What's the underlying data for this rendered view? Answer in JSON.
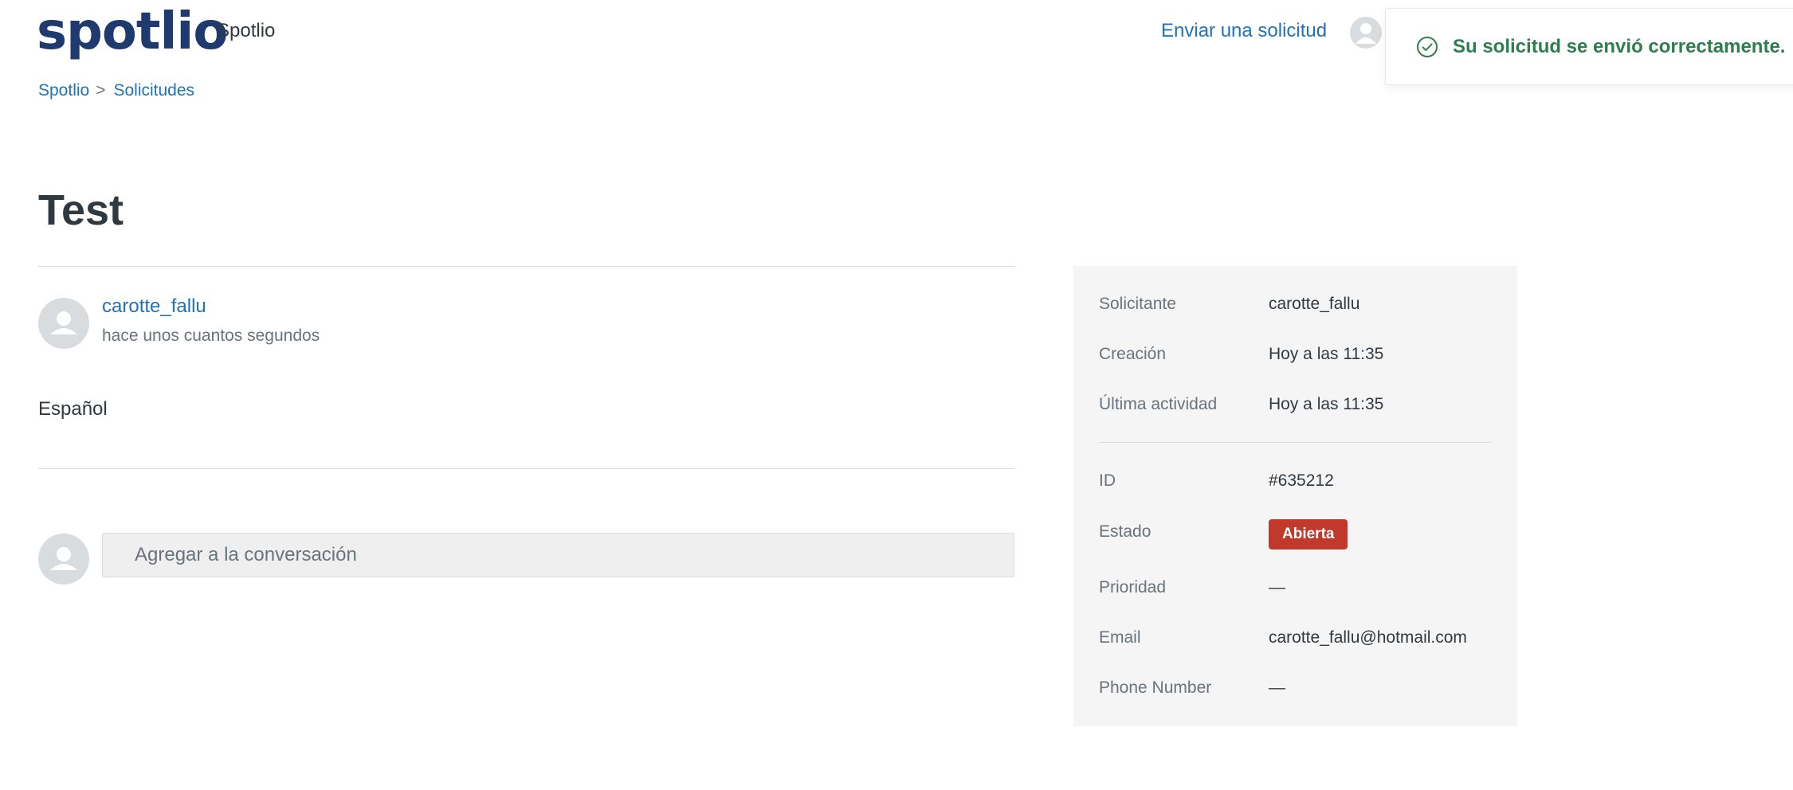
{
  "header": {
    "logo_text": "spotlio",
    "brand_name": "Spotlio",
    "submit_request": "Enviar una solicitud"
  },
  "toast": {
    "message": "Su solicitud se envió correctamente."
  },
  "breadcrumb": {
    "items": [
      "Spotlio",
      "Solicitudes"
    ],
    "separator": ">"
  },
  "request": {
    "title": "Test"
  },
  "comment": {
    "author": "carotte_fallu",
    "time": "hace unos cuantos segundos",
    "body": "Español"
  },
  "reply": {
    "placeholder": "Agregar a la conversación"
  },
  "sidebar": {
    "fields": [
      {
        "label": "Solicitante",
        "value": "carotte_fallu"
      },
      {
        "label": "Creación",
        "value": "Hoy a las 11:35"
      },
      {
        "label": "Última actividad",
        "value": "Hoy a las 11:35"
      },
      {
        "label": "ID",
        "value": "#635212"
      },
      {
        "label": "Estado",
        "value": "Abierta"
      },
      {
        "label": "Prioridad",
        "value": "—"
      },
      {
        "label": "Email",
        "value": "carotte_fallu@hotmail.com"
      },
      {
        "label": "Phone Number",
        "value": "—"
      }
    ]
  },
  "colors": {
    "brand": "#1f3a6e",
    "link": "#1f73b7",
    "success": "#2e7d4f",
    "status_open": "#c0392b",
    "sidebar_bg": "#f5f5f5"
  },
  "icons": {
    "toast": "check-circle-icon",
    "avatar": "user-avatar-icon"
  }
}
